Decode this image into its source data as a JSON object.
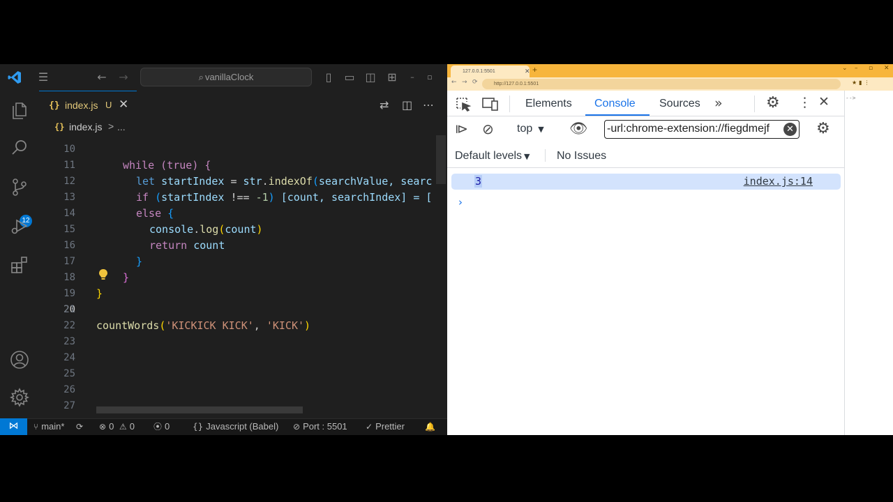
{
  "vscode": {
    "search_text": "vanillaClock",
    "tab": {
      "icon_text": "{}",
      "filename": "index.js",
      "status": "U"
    },
    "breadcrumb": {
      "icon_text": "{}",
      "file": "index.js",
      "separator": ">",
      "more": "..."
    },
    "editor": {
      "line_numbers": [
        "10",
        "11",
        "12",
        "13",
        "14",
        "15",
        "16",
        "17",
        "18",
        "19",
        "20",
        "21",
        "22",
        "23",
        "24",
        "25",
        "26",
        "27"
      ],
      "active_line": "20",
      "code": {
        "l10": "while (true) {",
        "l11_kw": "let",
        "l11_var": "startIndex",
        "l11_op": "=",
        "l11_obj": "str",
        "l11_fn": "indexOf",
        "l11_args": "searchValue, searc",
        "l12_kw": "if",
        "l12_var": "startIndex",
        "l12_op": "!==",
        "l12_num": "-1",
        "l12_rest": "[count, searchIndex] = [",
        "l13_kw": "else",
        "l14_obj": "console",
        "l14_fn": "log",
        "l14_arg": "count",
        "l15_kw": "return",
        "l15_var": "count",
        "l20_fn": "countWords",
        "l20_s1": "'KICKICK KICK'",
        "l20_s2": "'KICK'"
      }
    },
    "status": {
      "branch": "main*",
      "errors": "0",
      "warnings": "0",
      "ports": "0",
      "language": "Javascript (Babel)",
      "port": "Port : 5501",
      "formatter": "Prettier"
    },
    "source_control_badge": "12",
    "accent_color": "#0078d4"
  },
  "chrome": {
    "tab_title": "127.0.0.1:5501",
    "url": "http://127.0.0.1:5501",
    "tab_color": "#f7b53c"
  },
  "devtools": {
    "tabs": [
      "Elements",
      "Console",
      "Sources"
    ],
    "active_tab": "Console",
    "context": "top",
    "filter_value": "-url:chrome-extension://fiegdmejf",
    "levels": "Default levels",
    "issues": "No Issues",
    "messages": [
      {
        "value": "3",
        "source": "index.js:14"
      }
    ],
    "side_text": "-->"
  }
}
